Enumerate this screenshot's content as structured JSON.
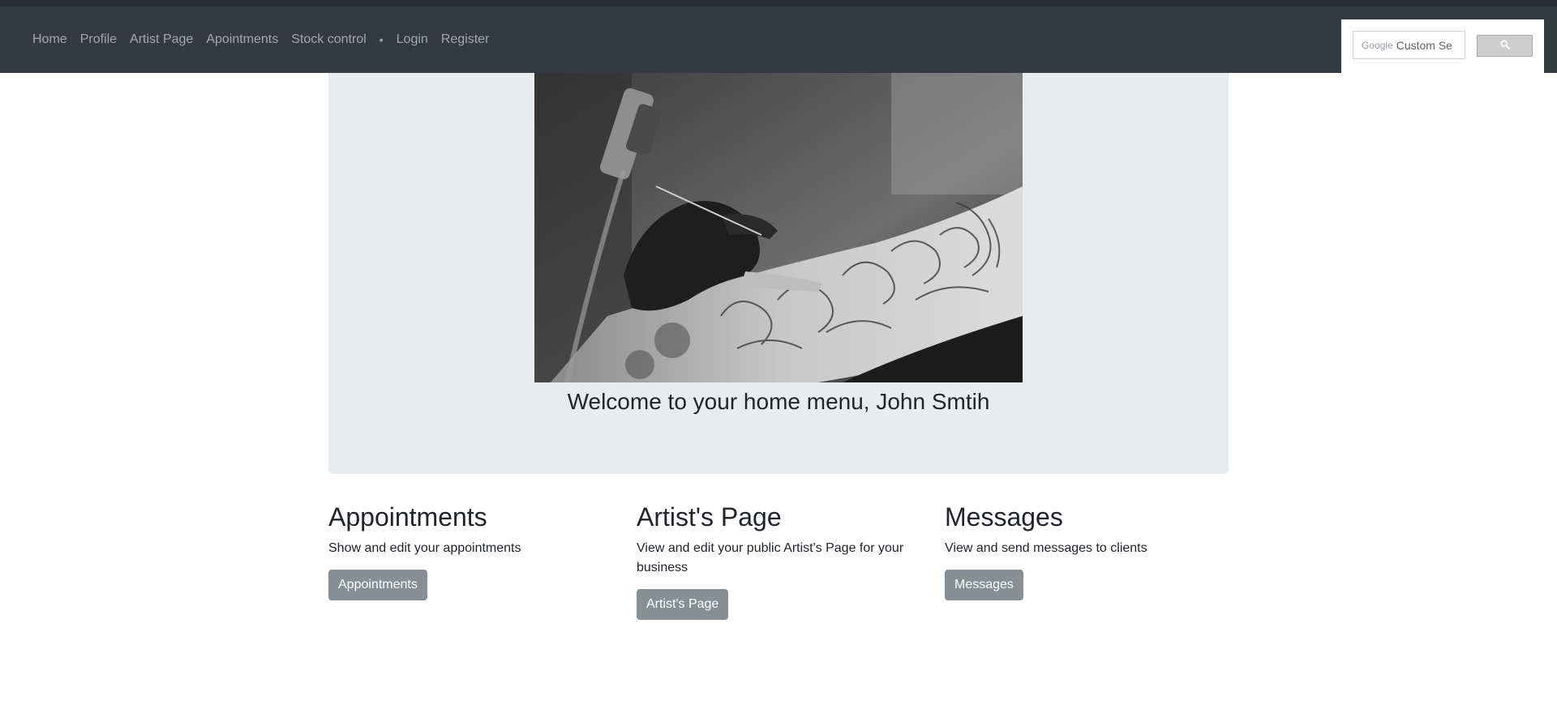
{
  "navbar": {
    "links": [
      "Home",
      "Profile",
      "Artist Page",
      "Apointments",
      "Stock control",
      "Login",
      "Register"
    ],
    "divider": "•"
  },
  "search": {
    "brand": "Google",
    "placeholder": "Custom Se",
    "button_icon": "search-icon"
  },
  "hero": {
    "image_alt": "tattoo-artist-image",
    "welcome": "Welcome to your home menu, John Smtih"
  },
  "cards": [
    {
      "title": "Appointments",
      "description": "Show and edit your appointments",
      "button": "Appointments"
    },
    {
      "title": "Artist's Page",
      "description": "View and edit your public Artist's Page for your business",
      "button": "Artist's Page"
    },
    {
      "title": "Messages",
      "description": "View and send messages to clients",
      "button": "Messages"
    }
  ],
  "colors": {
    "navbar": "#343a40",
    "jumbotron": "#e9ecef",
    "button": "#868e96"
  }
}
